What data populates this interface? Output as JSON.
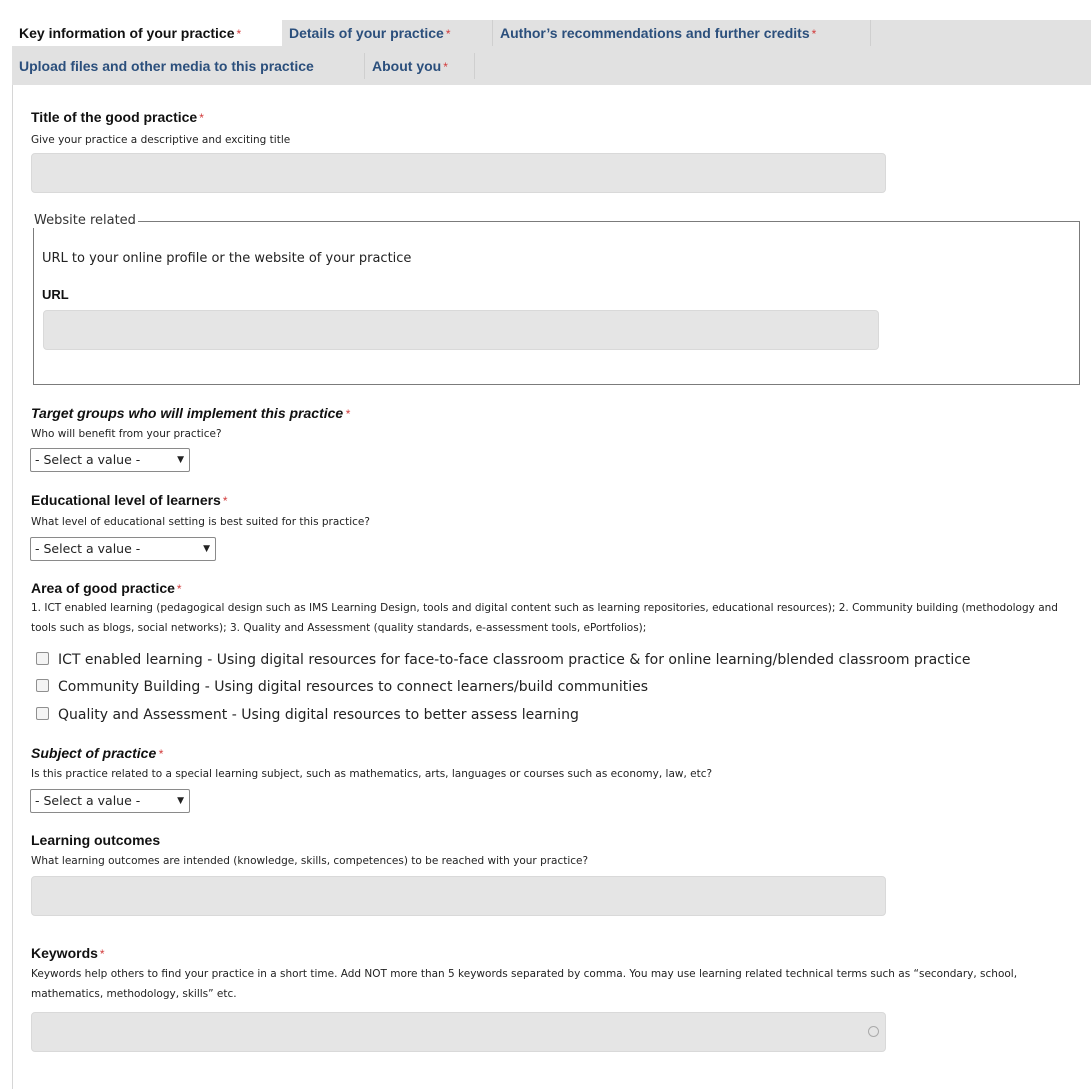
{
  "tabs": [
    {
      "label": "Key information of your practice",
      "required": "*",
      "active": true
    },
    {
      "label": "Details of your practice",
      "required": "*"
    },
    {
      "label": "Author’s recommendations and further credits",
      "required": "*"
    },
    {
      "label": "Upload files and other media to this practice",
      "required": ""
    },
    {
      "label": "About you",
      "required": "*"
    }
  ],
  "form": {
    "title_field": {
      "label": "Title of the good practice",
      "required": "*",
      "description": "Give your practice a descriptive and exciting title",
      "value": ""
    },
    "website": {
      "legend": "Website related",
      "description": "URL to your online profile or the website of your practice",
      "url_label": "URL",
      "url_value": ""
    },
    "target_groups": {
      "label": "Target groups who will implement this practice",
      "required": "*",
      "description": "Who will benefit from your practice?",
      "selected": "- Select a value -"
    },
    "educational_level": {
      "label": "Educational level of learners",
      "required": "*",
      "description": "What level of educational setting is best suited for this practice?",
      "selected": "- Select a value -"
    },
    "area": {
      "label": "Area of good practice",
      "required": "*",
      "description": "1. ICT enabled learning (pedagogical design such as IMS Learning Design, tools and digital content such as learning repositories, educational resources); 2. Community building (methodology and tools such as blogs, social networks); 3. Quality and Assessment (quality standards, e-assessment tools, ePortfolios);",
      "options": [
        {
          "label": "ICT enabled learning - Using digital resources for face-to-face classroom practice & for online learning/blended classroom practice",
          "checked": false
        },
        {
          "label": "Community Building - Using digital resources to connect learners/build communities",
          "checked": false
        },
        {
          "label": "Quality and Assessment - Using digital resources to better assess learning",
          "checked": false
        }
      ]
    },
    "subject": {
      "label": "Subject of practice",
      "required": "*",
      "description": "Is this practice related to a special learning subject, such as mathematics, arts, languages or courses such as economy, law, etc?",
      "selected": "- Select a value -"
    },
    "learning_outcomes": {
      "label": "Learning outcomes",
      "description": "What learning outcomes are intended (knowledge, skills, competences) to be reached with your practice?",
      "value": ""
    },
    "keywords": {
      "label": "Keywords",
      "required": "*",
      "description": "Keywords help others to find your practice in a short time. Add NOT more than 5 keywords separated by comma. You may use learning related technical terms such as “secondary, school, mathematics, methodology, skills” etc.",
      "value": ""
    }
  },
  "colors": {
    "tab_bar": "#e1e1e1",
    "tab_link": "#2b4f7c",
    "required": "#d23a3a",
    "input_bg": "#e5e5e5"
  }
}
